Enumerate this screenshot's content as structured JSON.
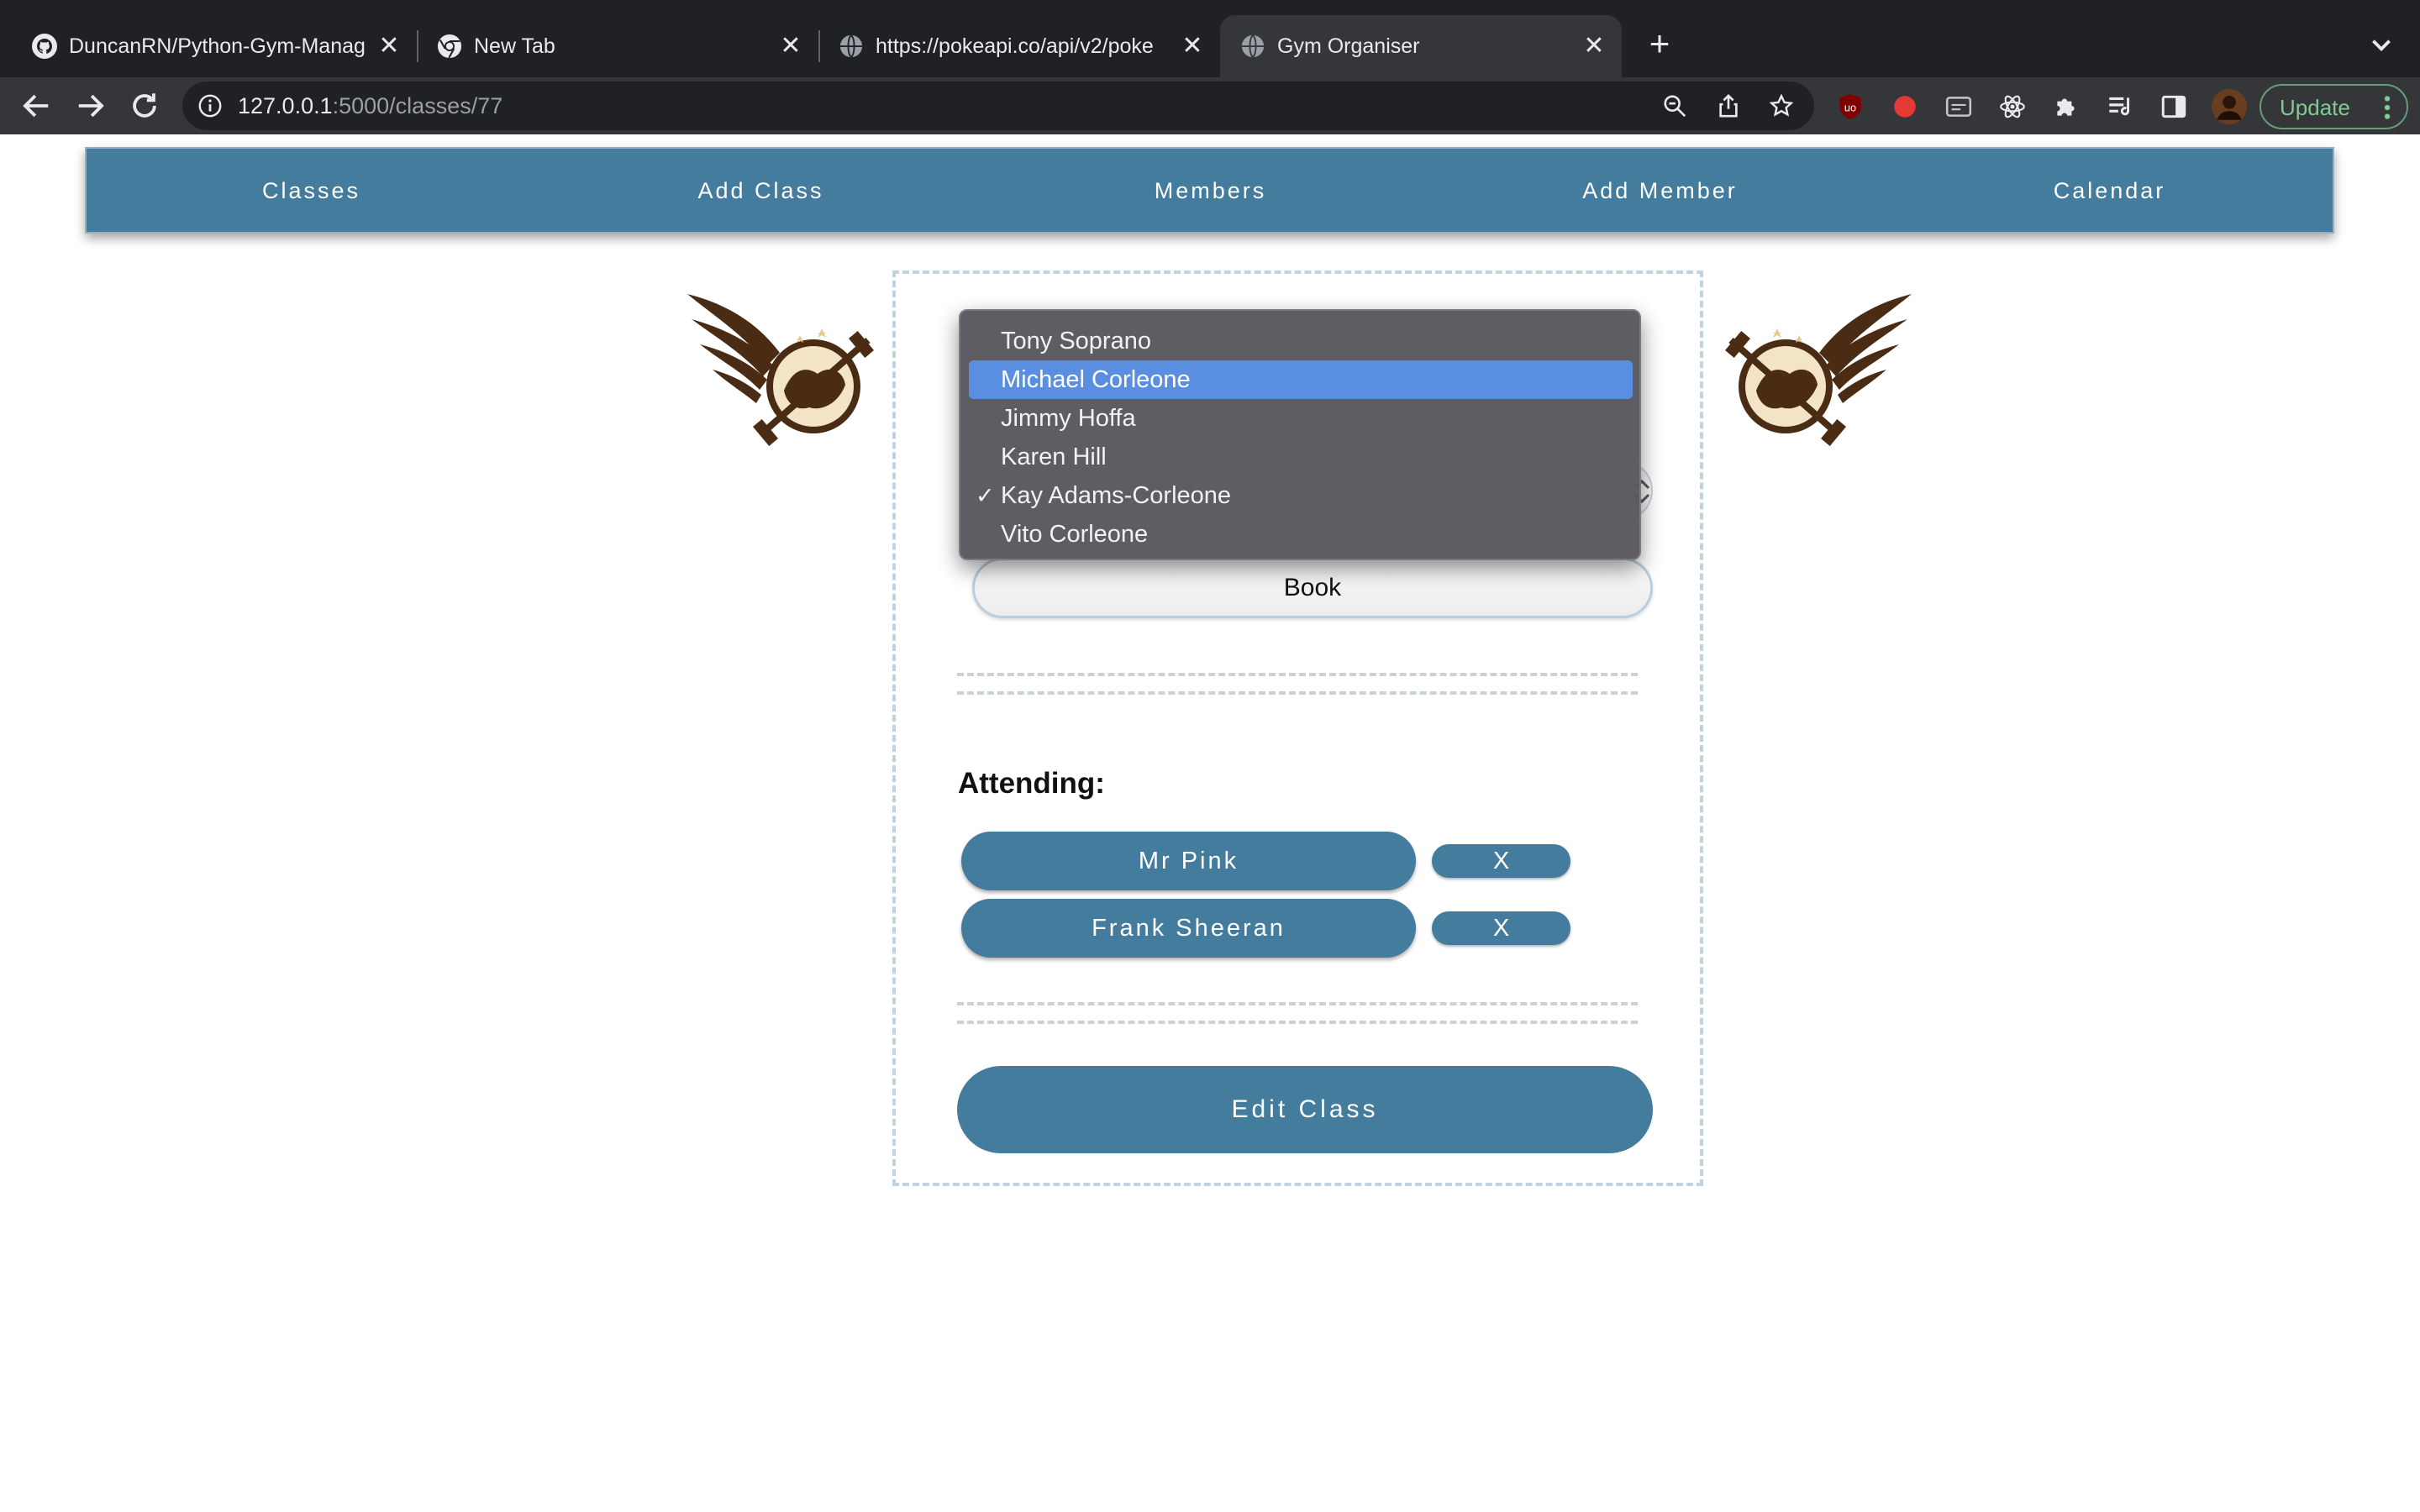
{
  "browser": {
    "tabs": [
      {
        "title": "DuncanRN/Python-Gym-Manag",
        "icon": "github-icon",
        "active": false
      },
      {
        "title": "New Tab",
        "icon": "chrome-icon",
        "active": false
      },
      {
        "title": "https://pokeapi.co/api/v2/poke",
        "icon": "globe-icon",
        "active": false
      },
      {
        "title": "Gym Organiser",
        "icon": "globe-icon",
        "active": true
      }
    ],
    "close_glyph": "✕",
    "new_tab_glyph": "+",
    "url": {
      "host": "127.0.0.1",
      "path": ":5000/classes/77"
    },
    "update_label": "Update"
  },
  "nav": {
    "items": [
      "Classes",
      "Add Class",
      "Members",
      "Add Member",
      "Calendar"
    ]
  },
  "booking": {
    "options": [
      "Tony Soprano",
      "Michael Corleone",
      "Jimmy Hoffa",
      "Karen Hill",
      "Kay Adams-Corleone",
      "Vito Corleone"
    ],
    "highlighted_option": "Michael Corleone",
    "checked_option": "Kay Adams-Corleone",
    "check_glyph": "✓",
    "book_label": "Book"
  },
  "attending": {
    "label": "Attending:",
    "members": [
      {
        "name": "Mr Pink",
        "remove_label": "X"
      },
      {
        "name": "Frank Sheeran",
        "remove_label": "X"
      }
    ]
  },
  "edit_label": "Edit Class",
  "colors": {
    "brand": "#437c9d",
    "highlight": "#5a8ee0",
    "chrome_dark": "#202124",
    "chrome_toolbar": "#35363a"
  }
}
